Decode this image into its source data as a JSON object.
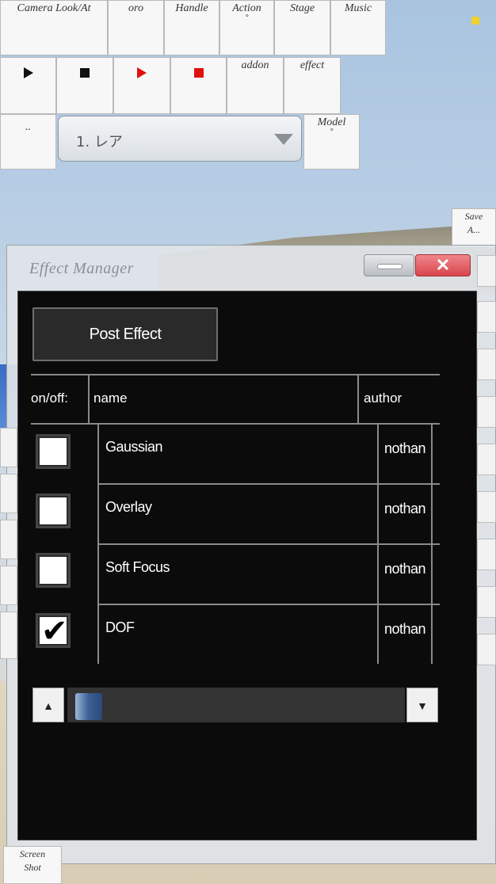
{
  "toolbar_row1": [
    {
      "label": "Camera Look/At",
      "sub": ""
    },
    {
      "label": "oro",
      "sub": ""
    },
    {
      "label": "Handle",
      "sub": ""
    },
    {
      "label": "Action",
      "sub": "°"
    },
    {
      "label": "Stage",
      "sub": ""
    },
    {
      "label": "Music",
      "sub": ""
    }
  ],
  "toolbar_row2": {
    "addon": "addon",
    "effect": "effect"
  },
  "toolbar_row3": {
    "dots": "..",
    "dropdown_value": "1. レア",
    "model_label": "Model",
    "model_sub": "°"
  },
  "save_button": {
    "line1": "Save",
    "line2": "A..."
  },
  "screenshot_button": {
    "line1": "Screen",
    "line2": "Shot"
  },
  "effect_manager": {
    "title": "Effect Manager",
    "close_glyph": "✕",
    "post_effect_button": "Post Effect",
    "headers": {
      "onoff": "on/off:",
      "name": "name",
      "author": "author"
    },
    "rows": [
      {
        "name": "Gaussian",
        "author": "nothan",
        "checked": false
      },
      {
        "name": "Overlay",
        "author": "nothan",
        "checked": false
      },
      {
        "name": "Soft Focus",
        "author": "nothan",
        "checked": false
      },
      {
        "name": "DOF",
        "author": "nothan",
        "checked": true
      }
    ],
    "scroll_up_glyph": "▲",
    "scroll_down_glyph": "▼",
    "scroll_position": 0.0
  },
  "colors": {
    "panel_bg": "#0b0b0b",
    "play_red": "#e01010",
    "close_red": "#d9464c"
  }
}
